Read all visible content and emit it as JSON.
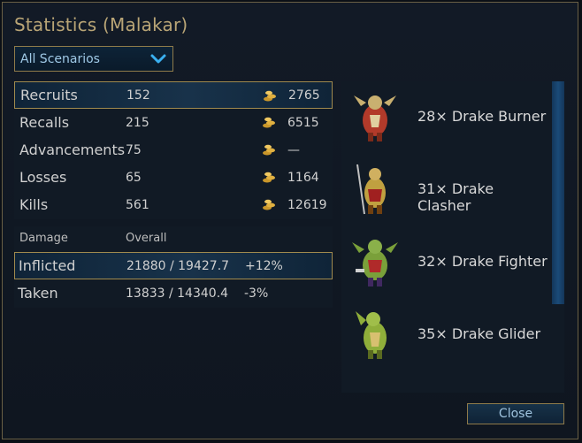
{
  "title": "Statistics (Malakar)",
  "scenario_select": {
    "value": "All Scenarios"
  },
  "stats": [
    {
      "label": "Recruits",
      "value": "152",
      "gold": "2765"
    },
    {
      "label": "Recalls",
      "value": "215",
      "gold": "6515"
    },
    {
      "label": "Advancements",
      "value": "75",
      "gold": "—"
    },
    {
      "label": "Losses",
      "value": "65",
      "gold": "1164"
    },
    {
      "label": "Kills",
      "value": "561",
      "gold": "12619"
    }
  ],
  "damage": {
    "header_label": "Damage",
    "header_overall": "Overall",
    "rows": [
      {
        "label": "Inflicted",
        "value": "21880 / 19427.7",
        "percent": "+12%"
      },
      {
        "label": "Taken",
        "value": "13833 / 14340.4",
        "percent": "-3%"
      }
    ]
  },
  "units": [
    {
      "label": "28× Drake Burner",
      "icon": "drake-burner-icon",
      "color": "#b23a2a"
    },
    {
      "label": "31× Drake Clasher",
      "icon": "drake-clasher-icon",
      "color": "#c0a040"
    },
    {
      "label": "32× Drake Fighter",
      "icon": "drake-fighter-icon",
      "color": "#7aa03a"
    },
    {
      "label": "35× Drake Glider",
      "icon": "drake-glider-icon",
      "color": "#8fae3a"
    }
  ],
  "close_label": "Close",
  "colors": {
    "accent": "#b9a576",
    "select_border": "#a08a4e",
    "link_blue": "#9fc9e6"
  }
}
